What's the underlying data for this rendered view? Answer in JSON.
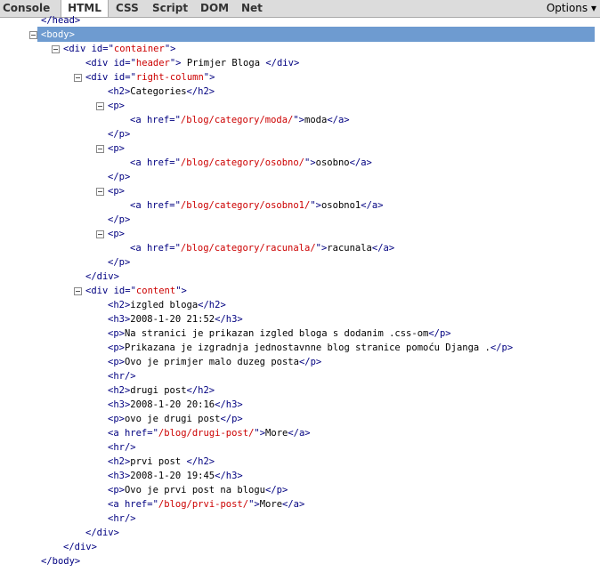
{
  "toolbar": {
    "tabs": [
      "Console",
      "HTML",
      "CSS",
      "Script",
      "DOM",
      "Net"
    ],
    "active_tab": "HTML",
    "options_label": "Options ▾"
  },
  "tree_lines": [
    {
      "indent": 46,
      "parts": [
        [
          "tg",
          "</head>"
        ]
      ]
    },
    {
      "indent": 46,
      "parts": [
        [
          "tg",
          "<body>"
        ]
      ],
      "twisty": true,
      "selected": true
    },
    {
      "indent": 71,
      "parts": [
        [
          "tg",
          "<div "
        ],
        [
          "an",
          "id"
        ],
        [
          "tg",
          "=\""
        ],
        [
          "av",
          "container"
        ],
        [
          "tg",
          "\">"
        ]
      ],
      "twisty": true
    },
    {
      "indent": 96,
      "parts": [
        [
          "tg",
          "<div "
        ],
        [
          "an",
          "id"
        ],
        [
          "tg",
          "=\""
        ],
        [
          "av",
          "header"
        ],
        [
          "tg",
          "\">"
        ],
        [
          "tx",
          " Primjer Bloga "
        ],
        [
          "tg",
          "</div>"
        ]
      ]
    },
    {
      "indent": 96,
      "parts": [
        [
          "tg",
          "<div "
        ],
        [
          "an",
          "id"
        ],
        [
          "tg",
          "=\""
        ],
        [
          "av",
          "right-column"
        ],
        [
          "tg",
          "\">"
        ]
      ],
      "twisty": true
    },
    {
      "indent": 121,
      "parts": [
        [
          "tg",
          "<h2>"
        ],
        [
          "tx",
          "Categories"
        ],
        [
          "tg",
          "</h2>"
        ]
      ]
    },
    {
      "indent": 121,
      "parts": [
        [
          "tg",
          "<p>"
        ]
      ],
      "twisty": true
    },
    {
      "indent": 146,
      "parts": [
        [
          "tg",
          "<a "
        ],
        [
          "an",
          "href"
        ],
        [
          "tg",
          "=\""
        ],
        [
          "av",
          "/blog/category/moda/"
        ],
        [
          "tg",
          "\">"
        ],
        [
          "tx",
          "moda"
        ],
        [
          "tg",
          "</a>"
        ]
      ]
    },
    {
      "indent": 121,
      "parts": [
        [
          "tg",
          "</p>"
        ]
      ]
    },
    {
      "indent": 121,
      "parts": [
        [
          "tg",
          "<p>"
        ]
      ],
      "twisty": true
    },
    {
      "indent": 146,
      "parts": [
        [
          "tg",
          "<a "
        ],
        [
          "an",
          "href"
        ],
        [
          "tg",
          "=\""
        ],
        [
          "av",
          "/blog/category/osobno/"
        ],
        [
          "tg",
          "\">"
        ],
        [
          "tx",
          "osobno"
        ],
        [
          "tg",
          "</a>"
        ]
      ]
    },
    {
      "indent": 121,
      "parts": [
        [
          "tg",
          "</p>"
        ]
      ]
    },
    {
      "indent": 121,
      "parts": [
        [
          "tg",
          "<p>"
        ]
      ],
      "twisty": true
    },
    {
      "indent": 146,
      "parts": [
        [
          "tg",
          "<a "
        ],
        [
          "an",
          "href"
        ],
        [
          "tg",
          "=\""
        ],
        [
          "av",
          "/blog/category/osobno1/"
        ],
        [
          "tg",
          "\">"
        ],
        [
          "tx",
          "osobno1"
        ],
        [
          "tg",
          "</a>"
        ]
      ]
    },
    {
      "indent": 121,
      "parts": [
        [
          "tg",
          "</p>"
        ]
      ]
    },
    {
      "indent": 121,
      "parts": [
        [
          "tg",
          "<p>"
        ]
      ],
      "twisty": true
    },
    {
      "indent": 146,
      "parts": [
        [
          "tg",
          "<a "
        ],
        [
          "an",
          "href"
        ],
        [
          "tg",
          "=\""
        ],
        [
          "av",
          "/blog/category/racunala/"
        ],
        [
          "tg",
          "\">"
        ],
        [
          "tx",
          "racunala"
        ],
        [
          "tg",
          "</a>"
        ]
      ]
    },
    {
      "indent": 121,
      "parts": [
        [
          "tg",
          "</p>"
        ]
      ]
    },
    {
      "indent": 96,
      "parts": [
        [
          "tg",
          "</div>"
        ]
      ]
    },
    {
      "indent": 96,
      "parts": [
        [
          "tg",
          "<div "
        ],
        [
          "an",
          "id"
        ],
        [
          "tg",
          "=\""
        ],
        [
          "av",
          "content"
        ],
        [
          "tg",
          "\">"
        ]
      ],
      "twisty": true
    },
    {
      "indent": 121,
      "parts": [
        [
          "tg",
          "<h2>"
        ],
        [
          "tx",
          "izgled bloga"
        ],
        [
          "tg",
          "</h2>"
        ]
      ]
    },
    {
      "indent": 121,
      "parts": [
        [
          "tg",
          "<h3>"
        ],
        [
          "tx",
          "2008-1-20 21:52"
        ],
        [
          "tg",
          "</h3>"
        ]
      ]
    },
    {
      "indent": 121,
      "parts": [
        [
          "tg",
          "<p>"
        ],
        [
          "tx",
          "Na stranici je prikazan izgled bloga s dodanim .css-om"
        ],
        [
          "tg",
          "</p>"
        ]
      ]
    },
    {
      "indent": 121,
      "parts": [
        [
          "tg",
          "<p>"
        ],
        [
          "tx",
          "Prikazana je izgradnja jednostavnne blog stranice pomoću Djanga ."
        ],
        [
          "tg",
          "</p>"
        ]
      ]
    },
    {
      "indent": 121,
      "parts": [
        [
          "tg",
          "<p>"
        ],
        [
          "tx",
          "Ovo je primjer malo duzeg posta"
        ],
        [
          "tg",
          "</p>"
        ]
      ]
    },
    {
      "indent": 121,
      "parts": [
        [
          "tg",
          "<hr/>"
        ]
      ]
    },
    {
      "indent": 121,
      "parts": [
        [
          "tg",
          "<h2>"
        ],
        [
          "tx",
          "drugi post"
        ],
        [
          "tg",
          "</h2>"
        ]
      ]
    },
    {
      "indent": 121,
      "parts": [
        [
          "tg",
          "<h3>"
        ],
        [
          "tx",
          "2008-1-20 20:16"
        ],
        [
          "tg",
          "</h3>"
        ]
      ]
    },
    {
      "indent": 121,
      "parts": [
        [
          "tg",
          "<p>"
        ],
        [
          "tx",
          "ovo je drugi post"
        ],
        [
          "tg",
          "</p>"
        ]
      ]
    },
    {
      "indent": 121,
      "parts": [
        [
          "tg",
          "<a "
        ],
        [
          "an",
          "href"
        ],
        [
          "tg",
          "=\""
        ],
        [
          "av",
          "/blog/drugi-post/"
        ],
        [
          "tg",
          "\">"
        ],
        [
          "tx",
          "More"
        ],
        [
          "tg",
          "</a>"
        ]
      ]
    },
    {
      "indent": 121,
      "parts": [
        [
          "tg",
          "<hr/>"
        ]
      ]
    },
    {
      "indent": 121,
      "parts": [
        [
          "tg",
          "<h2>"
        ],
        [
          "tx",
          "prvi post "
        ],
        [
          "tg",
          "</h2>"
        ]
      ]
    },
    {
      "indent": 121,
      "parts": [
        [
          "tg",
          "<h3>"
        ],
        [
          "tx",
          "2008-1-20 19:45"
        ],
        [
          "tg",
          "</h3>"
        ]
      ]
    },
    {
      "indent": 121,
      "parts": [
        [
          "tg",
          "<p>"
        ],
        [
          "tx",
          "Ovo je prvi post na blogu"
        ],
        [
          "tg",
          "</p>"
        ]
      ]
    },
    {
      "indent": 121,
      "parts": [
        [
          "tg",
          "<a "
        ],
        [
          "an",
          "href"
        ],
        [
          "tg",
          "=\""
        ],
        [
          "av",
          "/blog/prvi-post/"
        ],
        [
          "tg",
          "\">"
        ],
        [
          "tx",
          "More"
        ],
        [
          "tg",
          "</a>"
        ]
      ]
    },
    {
      "indent": 121,
      "parts": [
        [
          "tg",
          "<hr/>"
        ]
      ]
    },
    {
      "indent": 96,
      "parts": [
        [
          "tg",
          "</div>"
        ]
      ]
    },
    {
      "indent": 71,
      "parts": [
        [
          "tg",
          "</div>"
        ]
      ]
    },
    {
      "indent": 46,
      "parts": [
        [
          "tg",
          "</body>"
        ]
      ]
    }
  ]
}
